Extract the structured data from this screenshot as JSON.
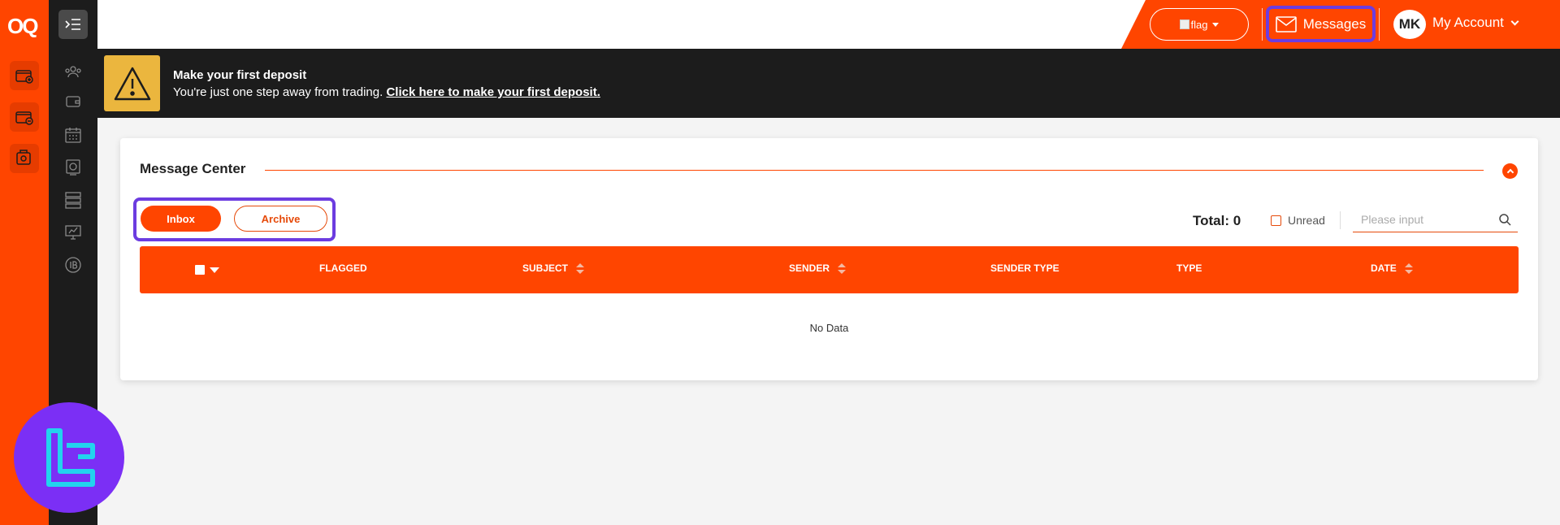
{
  "brand": {
    "logo_text": "OQ"
  },
  "topbar": {
    "flag_alt": "flag",
    "messages_label": "Messages",
    "avatar_initials": "MK",
    "account_label": "My Account"
  },
  "banner": {
    "title": "Make your first deposit",
    "text": "You're just one step away from trading. ",
    "link": "Click here to make your first deposit."
  },
  "message_center": {
    "title": "Message Center",
    "tabs": {
      "inbox": "Inbox",
      "archive": "Archive"
    },
    "total_label": "Total: 0",
    "unread_label": "Unread",
    "search_placeholder": "Please input",
    "columns": {
      "flagged": "FLAGGED",
      "subject": "SUBJECT",
      "sender": "SENDER",
      "sender_type": "SENDER TYPE",
      "type": "TYPE",
      "date": "DATE"
    },
    "empty_text": "No Data"
  },
  "colors": {
    "accent": "#ff4500",
    "sidebar": "#1c1c1c",
    "highlight": "#6c3ce0",
    "warning": "#ebb63e"
  },
  "icons": {
    "rail": [
      "deposit-wallet-icon",
      "withdraw-wallet-icon",
      "transfer-wallet-icon"
    ],
    "sidebar": [
      "menu-toggle-icon",
      "users-icon",
      "wallet-icon",
      "calendar-icon",
      "monitor-icon",
      "server-icon",
      "trading-platform-icon",
      "ib-icon"
    ]
  }
}
